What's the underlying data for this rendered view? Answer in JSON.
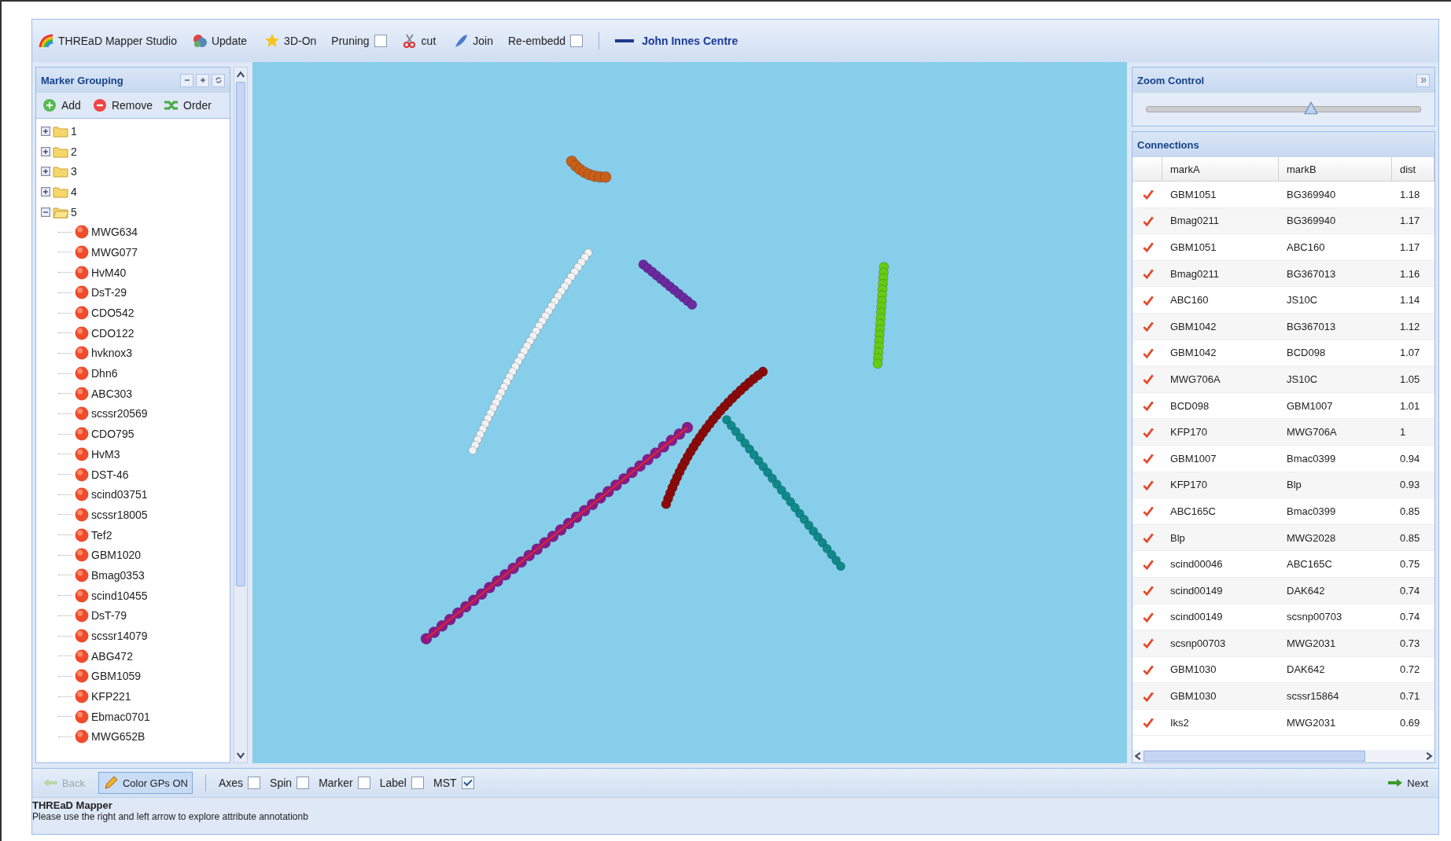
{
  "toolbar": [
    {
      "kind": "title",
      "label": "THREaD Mapper Studio"
    },
    {
      "kind": "button",
      "label": "Update"
    },
    {
      "kind": "button",
      "label": "3D-On"
    },
    {
      "kind": "checkbox",
      "label": "Pruning",
      "checked": false
    },
    {
      "kind": "button",
      "label": "cut"
    },
    {
      "kind": "button",
      "label": "Join"
    },
    {
      "kind": "checkbox",
      "label": "Re-embedd",
      "checked": false
    },
    {
      "kind": "link",
      "label": "John Innes Centre"
    }
  ],
  "marker_grouping": {
    "title": "Marker Grouping",
    "actions": [
      "Add",
      "Remove",
      "Order"
    ],
    "groups": [
      {
        "label": "1",
        "expanded": false
      },
      {
        "label": "2",
        "expanded": false
      },
      {
        "label": "3",
        "expanded": false
      },
      {
        "label": "4",
        "expanded": false
      },
      {
        "label": "5",
        "expanded": true,
        "children": [
          "MWG634",
          "MWG077",
          "HvM40",
          "DsT-29",
          "CDO542",
          "CDO122",
          "hvknox3",
          "Dhn6",
          "ABC303",
          "scssr20569",
          "CDO795",
          "HvM3",
          "DST-46",
          "scind03751",
          "scssr18005",
          "Tef2",
          "GBM1020",
          "Bmag0353",
          "scind10455",
          "DsT-79",
          "scssr14079",
          "ABG472",
          "GBM1059",
          "KFP221",
          "Ebmac0701",
          "MWG652B"
        ]
      }
    ]
  },
  "zoom_control": {
    "title": "Zoom Control",
    "level": 0.57
  },
  "connections": {
    "title": "Connections",
    "columns": [
      "markA",
      "markB",
      "dist"
    ],
    "rows": [
      {
        "checked": true,
        "cells": [
          "GBM1051",
          "BG369940",
          "1.18"
        ]
      },
      {
        "checked": true,
        "cells": [
          "Bmag0211",
          "BG369940",
          "1.17"
        ]
      },
      {
        "checked": true,
        "cells": [
          "GBM1051",
          "ABC160",
          "1.17"
        ]
      },
      {
        "checked": true,
        "cells": [
          "Bmag0211",
          "BG367013",
          "1.16"
        ]
      },
      {
        "checked": true,
        "cells": [
          "ABC160",
          "JS10C",
          "1.14"
        ]
      },
      {
        "checked": true,
        "cells": [
          "GBM1042",
          "BG367013",
          "1.12"
        ]
      },
      {
        "checked": true,
        "cells": [
          "GBM1042",
          "BCD098",
          "1.07"
        ]
      },
      {
        "checked": true,
        "cells": [
          "MWG706A",
          "JS10C",
          "1.05"
        ]
      },
      {
        "checked": true,
        "cells": [
          "BCD098",
          "GBM1007",
          "1.01"
        ]
      },
      {
        "checked": true,
        "cells": [
          "KFP170",
          "MWG706A",
          "1"
        ]
      },
      {
        "checked": true,
        "cells": [
          "GBM1007",
          "Bmac0399",
          "0.94"
        ]
      },
      {
        "checked": true,
        "cells": [
          "KFP170",
          "Blp",
          "0.93"
        ]
      },
      {
        "checked": true,
        "cells": [
          "ABC165C",
          "Bmac0399",
          "0.85"
        ]
      },
      {
        "checked": true,
        "cells": [
          "Blp",
          "MWG2028",
          "0.85"
        ]
      },
      {
        "checked": true,
        "cells": [
          "scind00046",
          "ABC165C",
          "0.75"
        ]
      },
      {
        "checked": true,
        "cells": [
          "scind00149",
          "DAK642",
          "0.74"
        ]
      },
      {
        "checked": true,
        "cells": [
          "scind00149",
          "scsnp00703",
          "0.74"
        ]
      },
      {
        "checked": true,
        "cells": [
          "scsnp00703",
          "MWG2031",
          "0.73"
        ]
      },
      {
        "checked": true,
        "cells": [
          "GBM1030",
          "DAK642",
          "0.72"
        ]
      },
      {
        "checked": true,
        "cells": [
          "GBM1030",
          "scssr15864",
          "0.71"
        ]
      },
      {
        "checked": true,
        "cells": [
          "Iks2",
          "MWG2031",
          "0.69"
        ]
      }
    ]
  },
  "bottom_toolbar": [
    {
      "kind": "button",
      "label": "Back",
      "disabled": true,
      "selected": false
    },
    {
      "kind": "toggle",
      "label": "Color GPs ON",
      "selected": true
    },
    {
      "kind": "checkbox",
      "label": "Axes",
      "checked": false
    },
    {
      "kind": "checkbox",
      "label": "Spin",
      "checked": false
    },
    {
      "kind": "checkbox",
      "label": "Marker",
      "checked": false
    },
    {
      "kind": "checkbox",
      "label": "Label",
      "checked": false
    },
    {
      "kind": "checkbox",
      "label": "MST",
      "checked": true
    },
    {
      "kind": "next",
      "label": "Next",
      "disabled": false,
      "selected": false
    }
  ],
  "status": {
    "title": "THREaD Mapper",
    "message": "Please use the right and left arrow to explore attribute annotationb"
  }
}
